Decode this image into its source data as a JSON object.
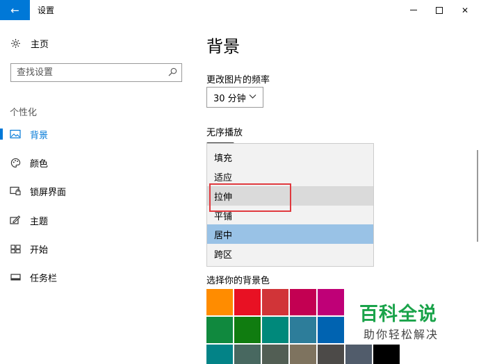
{
  "window": {
    "back_icon": "←",
    "title": "设置",
    "minimize_icon": "minimize-icon",
    "maximize_icon": "maximize-icon",
    "close_glyph": "✕"
  },
  "sidebar": {
    "home_label": "主页",
    "search_placeholder": "查找设置",
    "section_title": "个性化",
    "items": [
      {
        "label": "背景",
        "icon": "picture-icon",
        "active": true
      },
      {
        "label": "颜色",
        "icon": "palette-icon",
        "active": false
      },
      {
        "label": "锁屏界面",
        "icon": "lockscreen-icon",
        "active": false
      },
      {
        "label": "主题",
        "icon": "theme-icon",
        "active": false
      },
      {
        "label": "开始",
        "icon": "start-icon",
        "active": false
      },
      {
        "label": "任务栏",
        "icon": "taskbar-icon",
        "active": false
      }
    ]
  },
  "main": {
    "page_title": "背景",
    "change_freq_label": "更改图片的频率",
    "change_freq_value": "30 分钟",
    "shuffle_label": "无序播放",
    "fit_options": [
      {
        "label": "填充",
        "state": "normal"
      },
      {
        "label": "适应",
        "state": "normal"
      },
      {
        "label": "拉伸",
        "state": "hover"
      },
      {
        "label": "平铺",
        "state": "normal"
      },
      {
        "label": "居中",
        "state": "selected"
      },
      {
        "label": "跨区",
        "state": "normal"
      }
    ],
    "bg_color_label": "选择你的背景色",
    "swatch_colors": [
      [
        "#ff8c00",
        "#e81123",
        "#d13438",
        "#c30052",
        "#bf0077"
      ],
      [
        "#10893e",
        "#107c10",
        "#00897b",
        "#2d7d9a",
        "#0063b1"
      ],
      [
        "#038387",
        "#486860",
        "#525e54",
        "#7e735f",
        "#4c4a48",
        "#515c6b",
        "#000000"
      ]
    ]
  },
  "watermark": {
    "main_text": "百科全说",
    "sub_text": "助你轻松解决"
  },
  "colors": {
    "accent": "#0078d7",
    "highlight_border": "#e0393e",
    "watermark_green": "#1aa34a"
  }
}
